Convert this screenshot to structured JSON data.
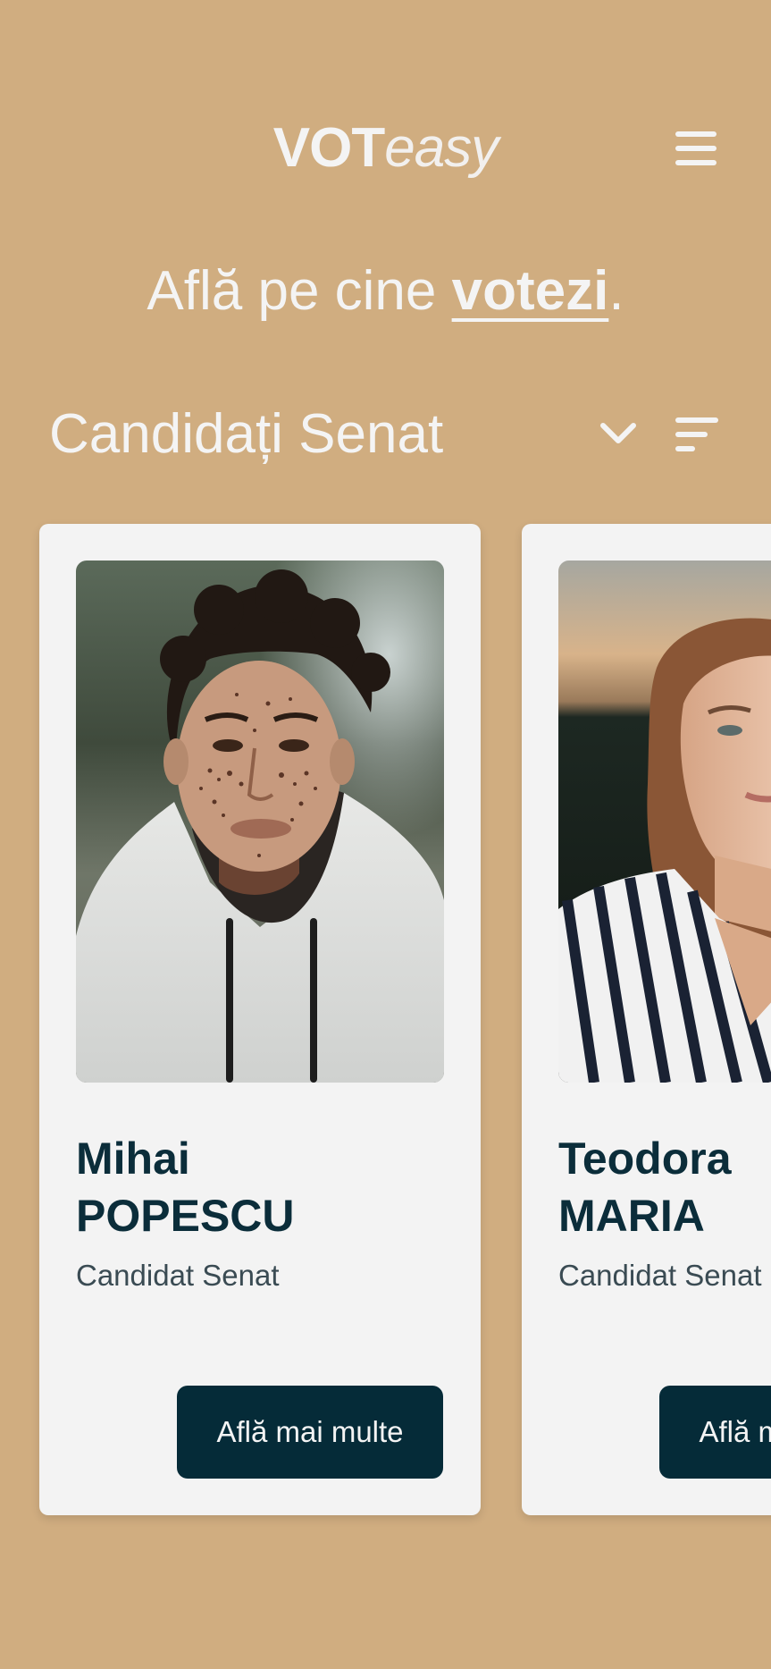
{
  "brand": {
    "logo_bold": "VOT",
    "logo_light": "easy"
  },
  "header": {
    "menu_icon": "hamburger-menu-icon"
  },
  "tagline": {
    "prefix": "Află pe cine ",
    "emphasis": "votezi",
    "suffix": "."
  },
  "section": {
    "title": "Candidați Senat",
    "dropdown_icon": "chevron-down-icon",
    "filter_icon": "sort-filter-icon"
  },
  "candidates": [
    {
      "first_name": "Mihai",
      "last_name": "POPESCU",
      "role": "Candidat Senat",
      "button_label": "Află mai multe"
    },
    {
      "first_name": "Teodora",
      "last_name": "MARIA",
      "role": "Candidat Senat",
      "button_label": "Află mai multe"
    }
  ],
  "colors": {
    "background": "#d0ad80",
    "card": "#f3f3f3",
    "heading": "#0b2d3a",
    "button": "#052b38",
    "text_light": "#f4f4f4"
  }
}
